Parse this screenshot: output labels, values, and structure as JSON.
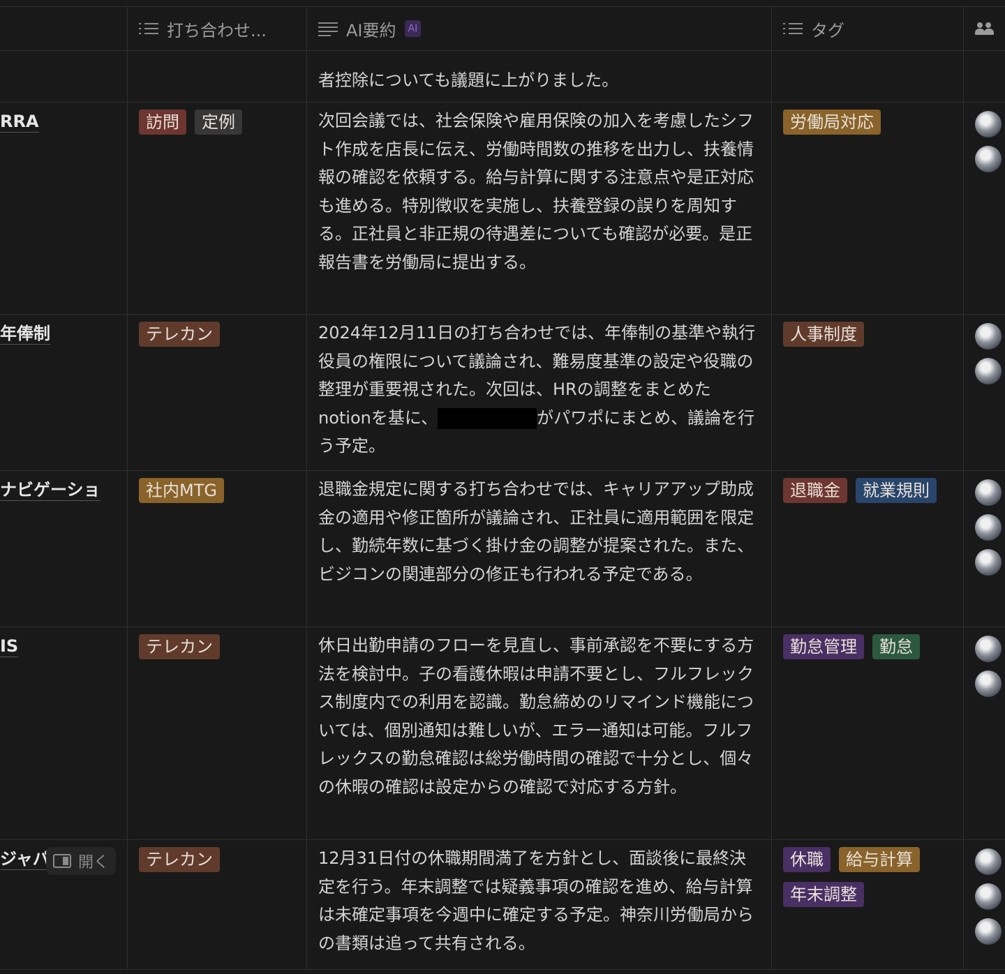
{
  "header": {
    "col_meeting_type": "打ち合わせ...",
    "col_ai_summary": "AI要約",
    "ai_badge": "AI",
    "col_tags": "タグ"
  },
  "top_partial_row": {
    "summary": "者控除についても議題に上がりました。"
  },
  "rows": [
    {
      "title": "RRA",
      "types": [
        {
          "label": "訪問",
          "color": "#6e3630"
        },
        {
          "label": "定例",
          "color": "#373737"
        }
      ],
      "summary": "次回会議では、社会保険や雇用保険の加入を考慮したシフト作成を店長に伝え、労働時間数の推移を出力し、扶養情報の確認を依頼する。給与計算に関する注意点や是正対応も進める。特別徴収を実施し、扶養登録の誤りを周知する。正社員と非正規の待遇差についても確認が必要。是正報告書を労働局に提出する。",
      "tags": [
        {
          "label": "労働局対応",
          "color": "#89632a"
        }
      ],
      "avatars": 2
    },
    {
      "title": "年俸制",
      "types": [
        {
          "label": "テレカン",
          "color": "#603b2c"
        }
      ],
      "summary_before": "2024年12月11日の打ち合わせでは、年俸制の基準や執行役員の権限について議論され、難易度基準の設定や役職の整理が重要視された。次回は、HRの調整をまとめたnotionを基に、",
      "summary_after": "がパワポにまとめ、議論を行う予定。",
      "tags": [
        {
          "label": "人事制度",
          "color": "#603b2c"
        }
      ],
      "avatars": 2
    },
    {
      "title": "ナビゲーショ",
      "types": [
        {
          "label": "社内MTG",
          "color": "#89632a"
        }
      ],
      "summary": "退職金規定に関する打ち合わせでは、キャリアアップ助成金の適用や修正箇所が議論され、正社員に適用範囲を限定し、勤続年数に基づく掛け金の調整が提案された。また、ビジコンの関連部分の修正も行われる予定である。",
      "tags": [
        {
          "label": "退職金",
          "color": "#6e3630"
        },
        {
          "label": "就業規則",
          "color": "#28456c"
        }
      ],
      "avatars": 3
    },
    {
      "title": "IS",
      "types": [
        {
          "label": "テレカン",
          "color": "#603b2c"
        }
      ],
      "summary": "休日出勤申請のフローを見直し、事前承認を不要にする方法を検討中。子の看護休暇は申請不要とし、フルフレックス制度内での利用を認識。勤怠締めのリマインド機能については、個別通知は難しいが、エラー通知は可能。フルフレックスの勤怠確認は総労働時間の確認で十分とし、個々の休暇の確認は設定からの確認で対応する方針。",
      "tags": [
        {
          "label": "勤怠管理",
          "color": "#492f64"
        },
        {
          "label": "勤怠",
          "color": "#2b593f"
        }
      ],
      "avatars": 2
    },
    {
      "title": "ジャパ",
      "open_label": "開く",
      "types": [
        {
          "label": "テレカン",
          "color": "#603b2c"
        }
      ],
      "summary": "12月31日付の休職期間満了を方針とし、面談後に最終決定を行う。年末調整では疑義事項の確認を進め、給与計算は未確定事項を今週中に確定する予定。神奈川労働局からの書類は追って共有される。",
      "tags": [
        {
          "label": "休職",
          "color": "#492f64"
        },
        {
          "label": "給与計算",
          "color": "#89632a"
        },
        {
          "label": "年末調整",
          "color": "#492f64"
        }
      ],
      "avatars": 3
    }
  ]
}
